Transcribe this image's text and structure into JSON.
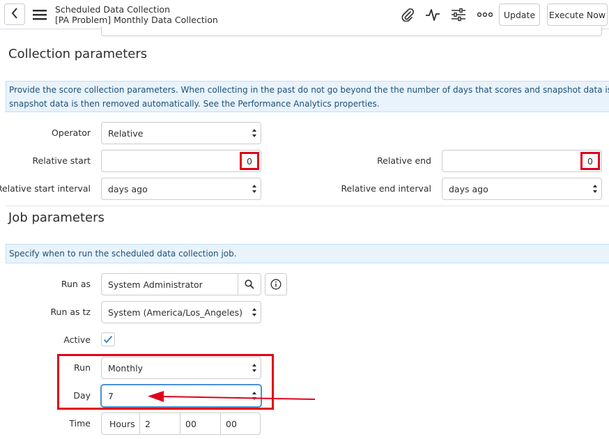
{
  "header": {
    "title": "Scheduled Data Collection",
    "subtitle": "[PA Problem] Monthly Data Collection",
    "back_icon": "chevron-left-icon",
    "menu_icon": "hamburger-menu-icon",
    "attachment_icon": "paperclip-icon",
    "activity_icon": "activity-pulse-icon",
    "personalize_icon": "sliders-icon",
    "more_icon": "more-options-icon",
    "update_label": "Update",
    "execute_label": "Execute Now"
  },
  "collection": {
    "title": "Collection parameters",
    "info_line1": "Provide the score collection parameters. When collecting in the past do not go beyond the the number of days that scores and snapshot data is retained, because",
    "info_line2": "snapshot data is then removed automatically. See the Performance Analytics properties.",
    "operator_label": "Operator",
    "operator_value": "Relative",
    "relative_start_label": "Relative start",
    "relative_start_value": "0",
    "relative_end_label": "Relative end",
    "relative_end_value": "0",
    "start_interval_label": "Relative start interval",
    "start_interval_value": "days ago",
    "end_interval_label": "Relative end interval",
    "end_interval_value": "days ago"
  },
  "job": {
    "title": "Job parameters",
    "info": "Specify when to run the scheduled data collection job.",
    "run_as_label": "Run as",
    "run_as_value": "System Administrator",
    "run_as_tz_label": "Run as tz",
    "run_as_tz_value": "System (America/Los_Angeles)",
    "active_label": "Active",
    "active_checked": true,
    "run_label": "Run",
    "run_value": "Monthly",
    "day_label": "Day",
    "day_value": "7",
    "time_label": "Time",
    "time_hours_label": "Hours",
    "time_hours": "2",
    "time_minutes": "00",
    "time_seconds": "00"
  },
  "colors": {
    "annotation_red": "#e3001b",
    "info_bg": "#e8f3fc",
    "focus_blue": "#4a90d9",
    "check_blue": "#2d7fc1"
  }
}
